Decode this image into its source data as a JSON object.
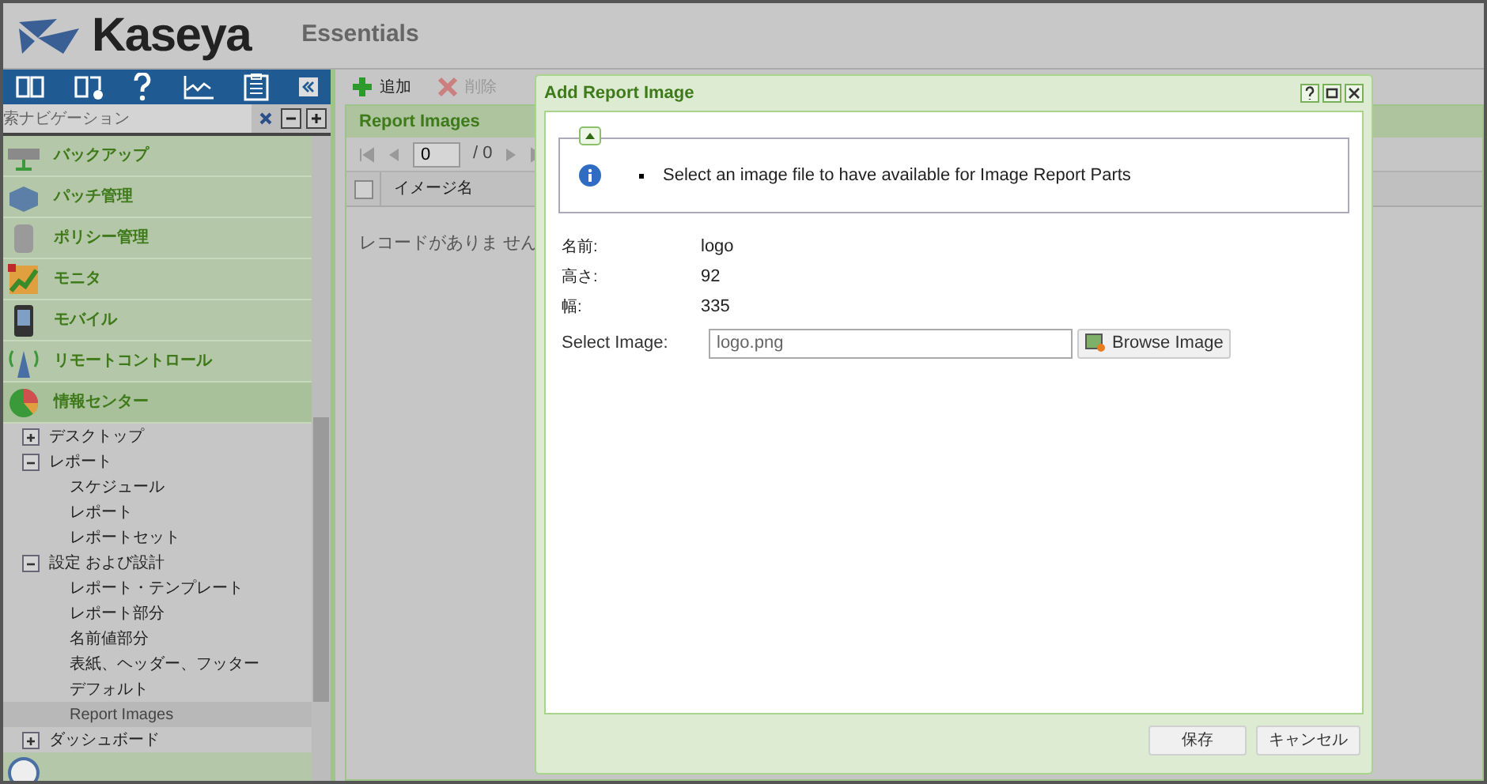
{
  "header": {
    "logo": "Kaseya",
    "product": "Essentials"
  },
  "sidebar": {
    "search": {
      "placeholder": "索ナビゲーション"
    },
    "modules": [
      {
        "label": "バックアップ",
        "kind": "drive",
        "expanded": false
      },
      {
        "label": "パッチ管理",
        "kind": "box",
        "expanded": false
      },
      {
        "label": "ポリシー管理",
        "kind": "scroll",
        "expanded": false
      },
      {
        "label": "モニタ",
        "kind": "chart",
        "expanded": false
      },
      {
        "label": "モバイル",
        "kind": "phone",
        "expanded": false
      },
      {
        "label": "リモートコントロール",
        "kind": "antenna",
        "expanded": false
      },
      {
        "label": "情報センター",
        "kind": "pie",
        "expanded": true,
        "children": [
          {
            "label": "デスクトップ",
            "expanded": false,
            "selected": false
          },
          {
            "label": "レポート",
            "expanded": true,
            "selected": false,
            "children": [
              {
                "label": "スケジュール",
                "selected": false
              },
              {
                "label": "レポート",
                "selected": false
              },
              {
                "label": "レポートセット",
                "selected": false
              }
            ]
          },
          {
            "label": "設定 および設計",
            "expanded": true,
            "selected": false,
            "children": [
              {
                "label": "レポート・テンプレート",
                "selected": false
              },
              {
                "label": "レポート部分",
                "selected": false
              },
              {
                "label": "名前値部分",
                "selected": false
              },
              {
                "label": "表紙、ヘッダー、フッター",
                "selected": false
              },
              {
                "label": "デフォルト",
                "selected": false
              },
              {
                "label": "Report Images",
                "selected": true
              }
            ]
          },
          {
            "label": "ダッシュボード",
            "expanded": false,
            "selected": false
          }
        ]
      }
    ]
  },
  "main": {
    "toolbar": [
      {
        "label": "追加",
        "kind": "add",
        "disabled": false
      },
      {
        "label": "削除",
        "kind": "delete",
        "disabled": true
      }
    ],
    "panel_title": "Report Images",
    "pager": {
      "page": "0",
      "total": "/ 0"
    },
    "grid": {
      "select_all_checked": false,
      "columns": [
        "イメージ名"
      ],
      "empty_text": "レコードがありま せん"
    }
  },
  "dialog": {
    "title": "Add Report Image",
    "info": "Select an image file to have available for Image Report Parts",
    "fields": [
      {
        "label": "名前:",
        "value": "logo"
      },
      {
        "label": "高さ:",
        "value": "92"
      },
      {
        "label": "幅:",
        "value": "335"
      }
    ],
    "file": {
      "label": "Select Image:",
      "value": "logo.png",
      "button": "Browse Image"
    },
    "buttons": [
      "保存",
      "キャンセル"
    ]
  }
}
